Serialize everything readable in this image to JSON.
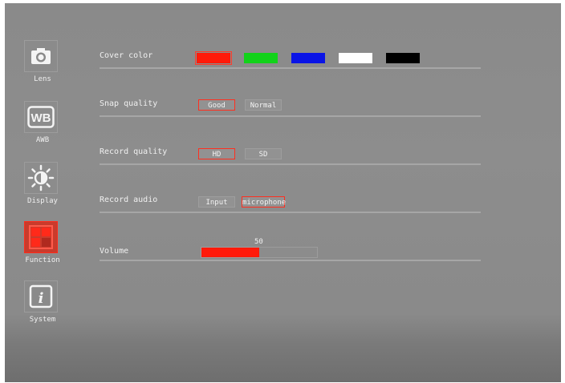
{
  "sidebar": {
    "items": [
      {
        "label": "Lens",
        "icon": "camera-icon"
      },
      {
        "label": "AWB",
        "icon": "wb-icon",
        "icon_text": "WB"
      },
      {
        "label": "Display",
        "icon": "brightness-icon"
      },
      {
        "label": "Function",
        "icon": "function-grid-icon",
        "active": true
      },
      {
        "label": "System",
        "icon": "info-icon",
        "icon_text": "i"
      }
    ]
  },
  "settings": {
    "cover_color": {
      "label": "Cover color",
      "swatches": [
        {
          "color": "#ff1a0a",
          "selected": true
        },
        {
          "color": "#12d21a",
          "selected": false
        },
        {
          "color": "#0a14e6",
          "selected": false
        },
        {
          "color": "#ffffff",
          "selected": false
        },
        {
          "color": "#000000",
          "selected": false
        }
      ]
    },
    "snap_quality": {
      "label": "Snap quality",
      "options": [
        {
          "label": "Good",
          "selected": true
        },
        {
          "label": "Normal",
          "selected": false
        }
      ]
    },
    "record_quality": {
      "label": "Record quality",
      "options": [
        {
          "label": "HD",
          "selected": true
        },
        {
          "label": "SD",
          "selected": false
        }
      ]
    },
    "record_audio": {
      "label": "Record audio",
      "options": [
        {
          "label": "Input",
          "selected": false
        },
        {
          "label": "microphone",
          "selected": true
        }
      ]
    },
    "volume": {
      "label": "Volume",
      "value": 50,
      "value_text": "50",
      "max": 100
    }
  },
  "colors": {
    "background": "#8a8a8a",
    "accent": "#ff2a1a",
    "active_item_fill": "#c93b2c"
  }
}
